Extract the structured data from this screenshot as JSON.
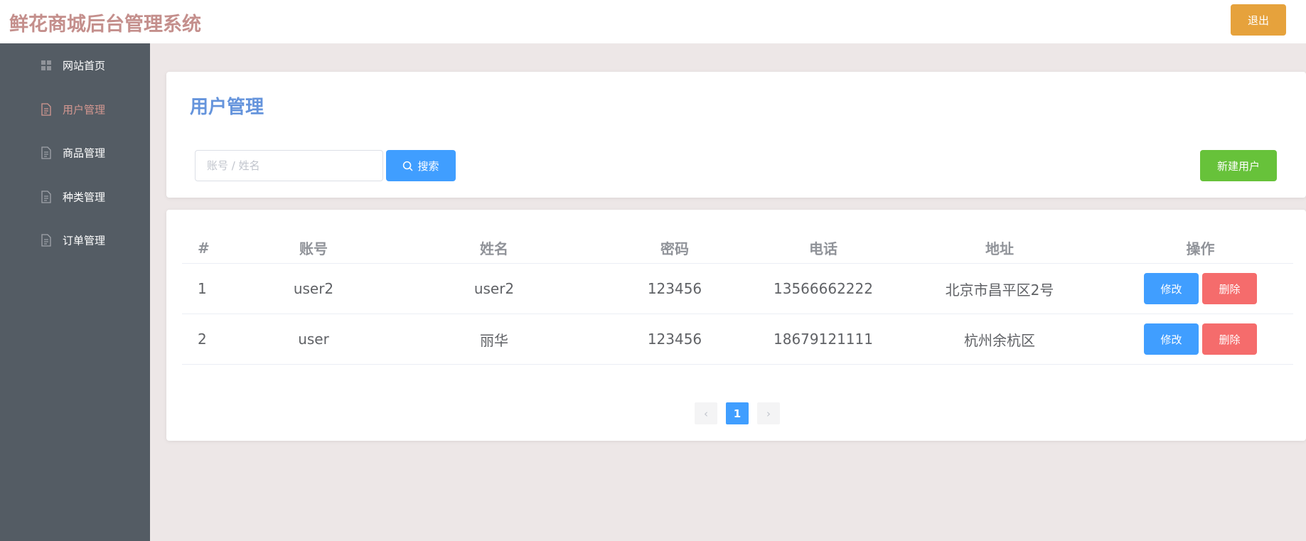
{
  "header": {
    "title": "鲜花商城后台管理系统",
    "logout_label": "退出",
    "accent_color": "#e6a23c",
    "title_color": "#c48f8c"
  },
  "sidebar": {
    "items": [
      {
        "label": "网站首页",
        "icon": "grid-icon",
        "active": false
      },
      {
        "label": "用户管理",
        "icon": "document-icon",
        "active": true
      },
      {
        "label": "商品管理",
        "icon": "document-icon",
        "active": false
      },
      {
        "label": "种类管理",
        "icon": "document-icon",
        "active": false
      },
      {
        "label": "订单管理",
        "icon": "document-icon",
        "active": false
      }
    ]
  },
  "main": {
    "page_title": "用户管理",
    "search": {
      "placeholder": "账号 / 姓名",
      "value": "",
      "button_label": "搜索",
      "icon": "search-icon"
    },
    "new_user_label": "新建用户",
    "table": {
      "columns": [
        "#",
        "账号",
        "姓名",
        "密码",
        "电话",
        "地址",
        "操作"
      ],
      "rows": [
        {
          "index": "1",
          "account": "user2",
          "name": "user2",
          "password": "123456",
          "phone": "13566662222",
          "address": "北京市昌平区2号"
        },
        {
          "index": "2",
          "account": "user",
          "name": "丽华",
          "password": "123456",
          "phone": "18679121111",
          "address": "杭州余杭区"
        }
      ],
      "edit_label": "修改",
      "delete_label": "删除"
    },
    "pagination": {
      "prev": "‹",
      "current": "1",
      "next": "›"
    }
  }
}
